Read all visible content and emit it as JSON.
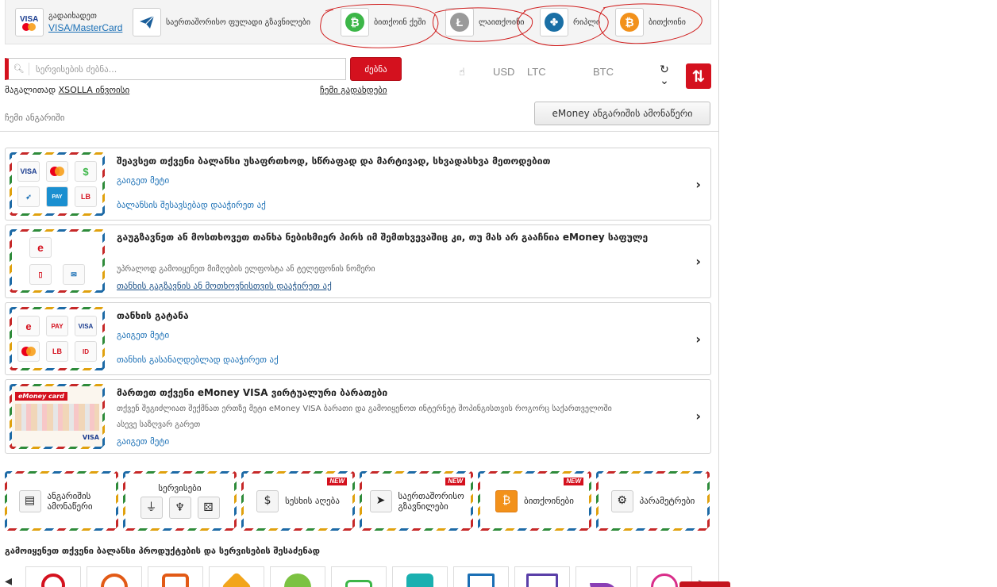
{
  "top_methods": [
    {
      "icon": "visa-mastercard-icon",
      "label": "გადაიხადეთ",
      "link": "VISA/MasterCard"
    },
    {
      "icon": "paper-plane-icon",
      "label": "საერთაშორისო ფულადი გზავნილები"
    },
    {
      "icon": "bitcoin-cash-icon",
      "label": "ბითქოინ ქეში",
      "color": "#3cb648"
    },
    {
      "icon": "litecoin-icon",
      "label": "ლაითქოინი",
      "color": "#9a9a9a"
    },
    {
      "icon": "ripple-icon",
      "label": "რიპლი",
      "color": "#1a6fa5"
    },
    {
      "icon": "bitcoin-icon",
      "label": "ბითქოინი",
      "color": "#f2911b"
    }
  ],
  "search": {
    "placeholder": "სერვისების ძებნა...",
    "button": "ძებნა"
  },
  "promo": {
    "prefix": "მაგალითად",
    "link": "XSOLLA ინვოისი"
  },
  "my_payments": "ჩემი გადახდები",
  "my_account": "ჩემი ანგარიში",
  "currencies": [
    "USD",
    "LTC",
    "BTC"
  ],
  "statement_button": "eMoney ანგარიშის ამონაწერი",
  "cards": [
    {
      "title": "შეავსეთ თქვენი ბალანსი უსაფრთხოდ, სწრაფად და მარტივად, სხვადასხვა მეთოდებით",
      "more": "გაიგეთ მეტი",
      "link": "ბალანსის შესავსებად დააჭირეთ აქ",
      "icons": [
        "VISA",
        "MC",
        "$",
        "~",
        "PAY",
        "LB"
      ]
    },
    {
      "title": "გაუგზავნეთ ან მოსთხოვეთ თანხა ნებისმიერ პირს იმ შემთხვევაშიც კი, თუ მას არ გააჩნია eMoney საფულე",
      "desc": "უპრალოდ გამოიყენეთ მიმღების ელფოსტა ან ტელეფონის ნომერი",
      "link": "თანხის გაგზავნის ან მოთხოვნისთვის დააჭირეთ აქ",
      "icons": [
        "e",
        "phone",
        "mail"
      ]
    },
    {
      "title": "თანხის გატანა",
      "more": "გაიგეთ მეტი",
      "link": "თანხის გასანაღდებლად დააჭირეთ აქ",
      "icons": [
        "e",
        "PAY",
        "VISA",
        "MC",
        "LB",
        "ID"
      ]
    },
    {
      "title": "მართეთ თქვენი eMoney VISA ვირტუალური ბარათები",
      "desc": "თქვენ შეგიძლიათ შექმნათ ერთზე მეტი eMoney VISA ბარათი და გამოიყენოთ ინტერნეტ შოპინგისთვის როგორც საქართველოში ასევე საზღვარ გარეთ",
      "more": "გაიგეთ მეტი",
      "icons": [
        "eMoney card",
        "VISA"
      ]
    }
  ],
  "tiles": [
    {
      "label": "ანგარიშის ამონაწერი",
      "icon": "statement-icon"
    },
    {
      "label": "სერვისები",
      "icon": "services-icon"
    },
    {
      "label": "სესხის აღება",
      "icon": "money-bag-icon",
      "badge": "NEW"
    },
    {
      "label": "საერთაშორისო გზავნილები",
      "icon": "paper-plane-icon",
      "badge": "NEW"
    },
    {
      "label": "ბითქოინები",
      "icon": "bitcoin-icon",
      "badge": "NEW"
    },
    {
      "label": "პარამეტრები",
      "icon": "gear-icon"
    }
  ],
  "bottom_title": "გამოიყენეთ თქვენი ბალანსი პროდუქტების და სერვისების შესაძენად",
  "brand_colors": {
    "accent_red": "#d4111e",
    "link_blue": "#1a6fb5"
  }
}
